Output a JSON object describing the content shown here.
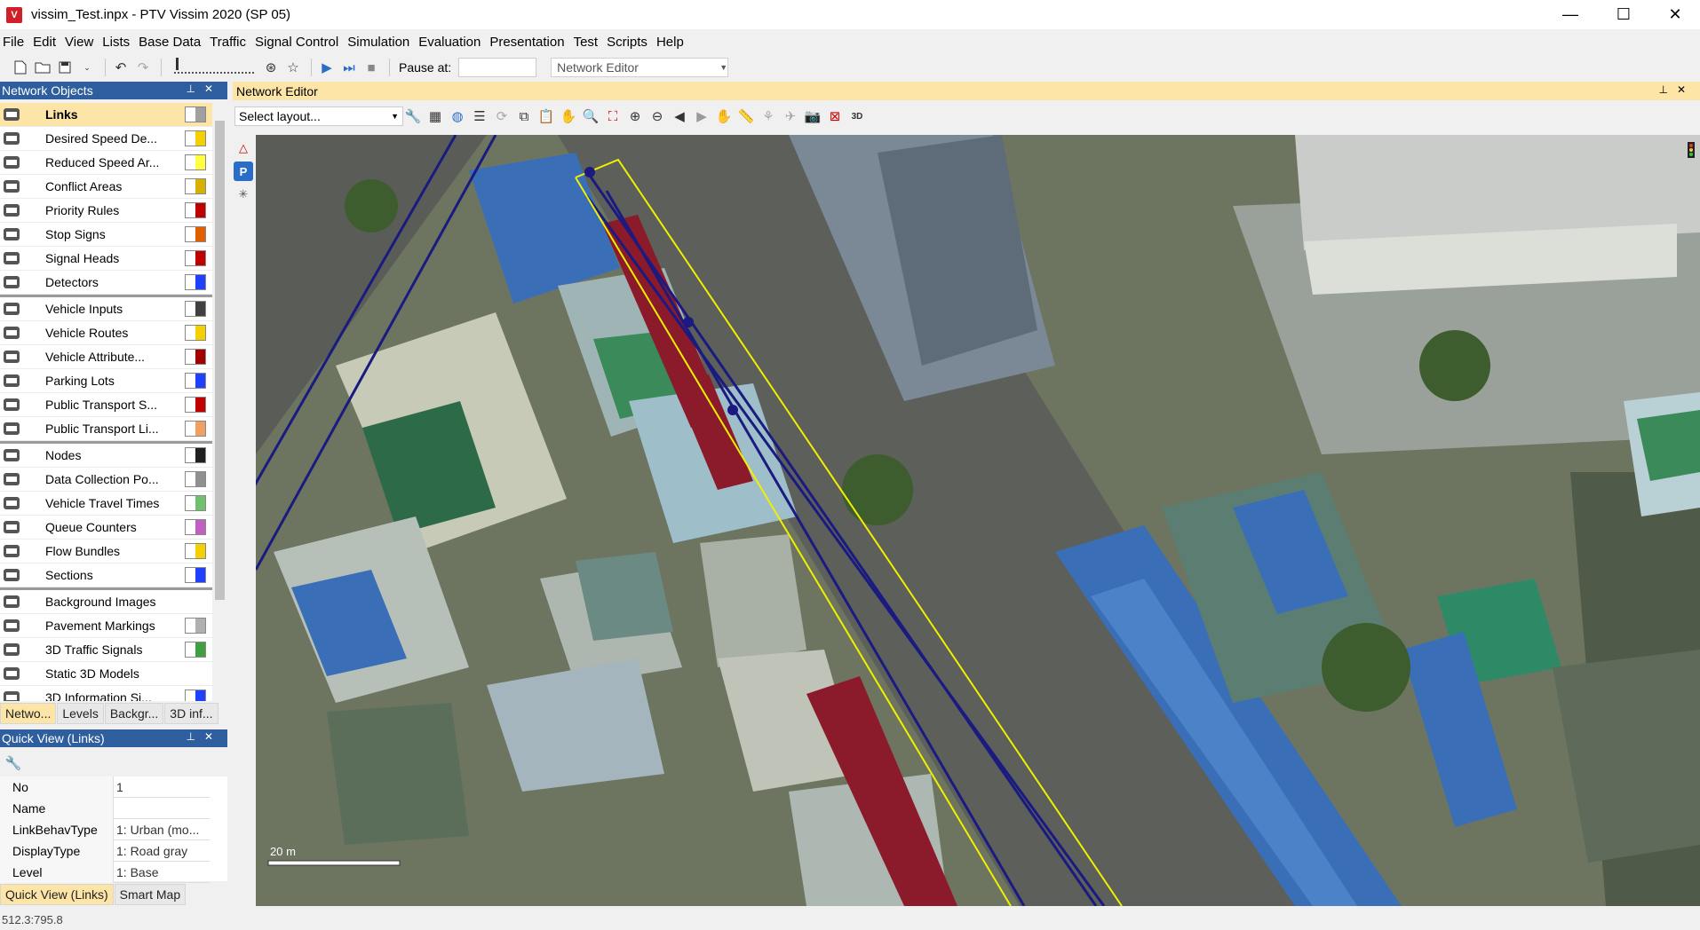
{
  "window": {
    "title": "vissim_Test.inpx - PTV Vissim 2020 (SP 05)",
    "app_icon_text": "V",
    "controls": {
      "minimize": "—",
      "maximize": "☐",
      "close": "✕"
    }
  },
  "menu": [
    "File",
    "Edit",
    "View",
    "Lists",
    "Base Data",
    "Traffic",
    "Signal Control",
    "Simulation",
    "Evaluation",
    "Presentation",
    "Test",
    "Scripts",
    "Help"
  ],
  "toolbar": {
    "pause_label": "Pause at:",
    "pause_value": "",
    "view_select": "Network Editor"
  },
  "network_objects": {
    "title": "Network Objects",
    "items": [
      {
        "label": "Links",
        "icon": "link-icon",
        "swatch": "#a0a0a0"
      },
      {
        "label": "Desired Speed De...",
        "icon": "speed-limit-icon",
        "swatch": "#f5d000"
      },
      {
        "label": "Reduced Speed Ar...",
        "icon": "triangle-warning-icon",
        "swatch": "#ffff40"
      },
      {
        "label": "Conflict Areas",
        "icon": "conflict-icon",
        "swatch": "#d8b000"
      },
      {
        "label": "Priority Rules",
        "icon": "yield-icon",
        "swatch": "#c00000"
      },
      {
        "label": "Stop Signs",
        "icon": "stop-sign-icon",
        "swatch": "#e06000"
      },
      {
        "label": "Signal Heads",
        "icon": "traffic-light-icon",
        "swatch": "#c00000"
      },
      {
        "label": "Detectors",
        "icon": "detector-icon",
        "swatch": "#2040ff"
      },
      {
        "label": "Vehicle Inputs",
        "icon": "car-icon",
        "swatch": "#404040"
      },
      {
        "label": "Vehicle Routes",
        "icon": "route-icon",
        "swatch": "#f5d000"
      },
      {
        "label": "Vehicle Attribute...",
        "icon": "car-attribute-icon",
        "swatch": "#a00000"
      },
      {
        "label": "Parking Lots",
        "icon": "parking-icon",
        "swatch": "#2040ff"
      },
      {
        "label": "Public Transport S...",
        "icon": "bus-stop-icon",
        "swatch": "#c00000"
      },
      {
        "label": "Public Transport Li...",
        "icon": "bus-line-icon",
        "swatch": "#f0a060"
      },
      {
        "label": "Nodes",
        "icon": "node-icon",
        "swatch": "#202020"
      },
      {
        "label": "Data Collection Po...",
        "icon": "data-collection-icon",
        "swatch": "#909090"
      },
      {
        "label": "Vehicle Travel Times",
        "icon": "stopwatch-icon",
        "swatch": "#70c070"
      },
      {
        "label": "Queue Counters",
        "icon": "queue-counter-icon",
        "swatch": "#c060c0"
      },
      {
        "label": "Flow Bundles",
        "icon": "flow-bundle-icon",
        "swatch": "#f5d000"
      },
      {
        "label": "Sections",
        "icon": "section-icon",
        "swatch": "#2040ff"
      },
      {
        "label": "Background Images",
        "icon": "image-icon",
        "swatch": ""
      },
      {
        "label": "Pavement Markings",
        "icon": "pavement-marking-icon",
        "swatch": "#b0b0b0"
      },
      {
        "label": "3D Traffic Signals",
        "icon": "3d-signal-icon",
        "swatch": "#40a040"
      },
      {
        "label": "Static 3D Models",
        "icon": "3d-model-icon",
        "swatch": ""
      },
      {
        "label": "3D Information Si...",
        "icon": "3d-info-icon",
        "swatch": "#2040ff"
      }
    ],
    "tabs": [
      "Netwo...",
      "Levels",
      "Backgr...",
      "3D inf..."
    ]
  },
  "quick_view": {
    "title": "Quick View (Links)",
    "rows": [
      {
        "key": "No",
        "value": "1"
      },
      {
        "key": "Name",
        "value": ""
      },
      {
        "key": "LinkBehavType",
        "value": "1: Urban (mo..."
      },
      {
        "key": "DisplayType",
        "value": "1: Road gray"
      },
      {
        "key": "Level",
        "value": "1: Base"
      }
    ],
    "tabs": [
      "Quick View (Links)",
      "Smart Map"
    ]
  },
  "editor": {
    "title": "Network Editor",
    "layout_placeholder": "Select layout...",
    "scale_label": "20 m"
  },
  "status": {
    "coordinates": "512.3:795.8"
  },
  "colors": {
    "panel_header": "#2f5e9e",
    "selection": "#fde5a8",
    "link_blue": "#1a1a80",
    "connector_yellow": "#f0f000"
  }
}
